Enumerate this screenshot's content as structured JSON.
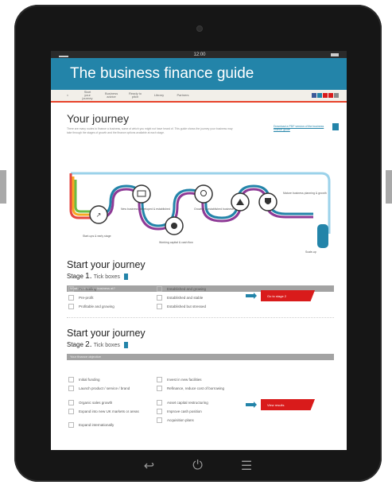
{
  "status": {
    "time": "12:00"
  },
  "banner": {
    "title": "The business finance guide"
  },
  "nav": {
    "items": [
      "Start your journey",
      "Business advice",
      "Ready to pitch",
      "Library",
      "Partners"
    ]
  },
  "journey": {
    "heading": "Your journey",
    "download_link": "Download a PDF version of the business finance guide",
    "intro": "There are many routes to finance a business, some of which you might not have heard of. This guide shows the journey your business may take through the stages of growth and the finance options available at each stage.",
    "pipeline_labels": [
      "Start-ups & early stage",
      "New business, developed & established",
      "Working capital & cash flow",
      "Growing & established business",
      "Mature business planning & growth",
      "Scale-up"
    ]
  },
  "stage1": {
    "title": "Start your journey",
    "stage_text": "Stage",
    "stage_num": "1.",
    "tick": "Tick boxes",
    "bar": "What stage is your business at?",
    "options": [
      "Pre-trading",
      "Pre-profit",
      "Profitable and growing",
      "Established and growing",
      "Established and stable",
      "Established but stressed"
    ],
    "button": "Go to stage 2"
  },
  "stage2": {
    "title": "Start your journey",
    "stage_text": "Stage",
    "stage_num": "2.",
    "tick": "Tick boxes",
    "bar": "Your finance objective",
    "options": [
      "Initial funding",
      "Launch product / service / brand",
      "Organic sales growth",
      "Expand into new UK markets or areas",
      "Expand internationally",
      "Invest in new facilities",
      "Refinance, reduce cost of borrowing",
      "Asset capital restructuring",
      "Improve cash position",
      "Acquisition plans"
    ],
    "button": "View results"
  },
  "homebar": {
    "back": "↩",
    "home": "⏻",
    "menu": "☰"
  },
  "colors": {
    "brand": "#2384a9",
    "accent": "#d91b1b",
    "nav_rule": "#e7432a"
  }
}
